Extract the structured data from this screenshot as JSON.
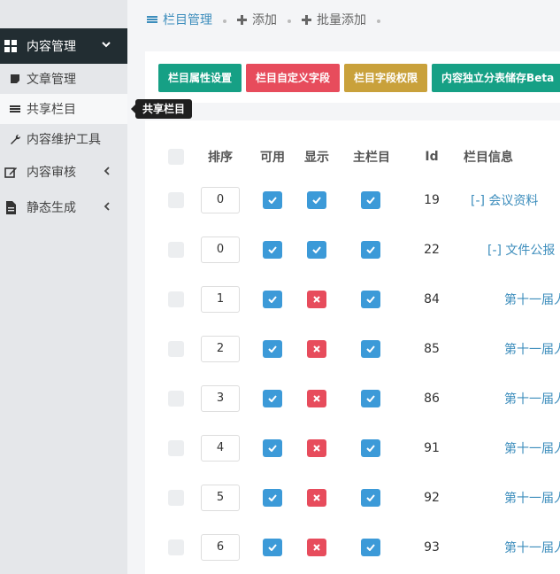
{
  "sidebar": {
    "section": "内容管理",
    "items": [
      {
        "label": "文章管理",
        "icon": "note-icon"
      },
      {
        "label": "共享栏目",
        "icon": "list-icon"
      },
      {
        "label": "内容维护工具",
        "icon": "wrench-icon"
      }
    ],
    "menus": [
      {
        "label": "内容审核",
        "icon": "edit-icon"
      },
      {
        "label": "静态生成",
        "icon": "file-icon"
      }
    ]
  },
  "tooltip": "共享栏目",
  "topnav": {
    "tabs": [
      "栏目管理",
      "添加",
      "批量添加"
    ]
  },
  "toolbar": {
    "buttons": [
      "栏目属性设置",
      "栏目自定义字段",
      "栏目字段权限",
      "内容独立分表储存Beta"
    ]
  },
  "table": {
    "headers": [
      "排序",
      "可用",
      "显示",
      "主栏目",
      "Id",
      "栏目信息"
    ],
    "rows": [
      {
        "sort": "0",
        "enabled": true,
        "display": true,
        "main": true,
        "id": "19",
        "info": "[-] 会议资料",
        "indent": 0
      },
      {
        "sort": "0",
        "enabled": true,
        "display": true,
        "main": true,
        "id": "22",
        "info": "[-] 文件公报",
        "indent": 1
      },
      {
        "sort": "1",
        "enabled": true,
        "display": false,
        "main": true,
        "id": "84",
        "info": "第十一届人",
        "indent": 2
      },
      {
        "sort": "2",
        "enabled": true,
        "display": false,
        "main": true,
        "id": "85",
        "info": "第十一届人",
        "indent": 2
      },
      {
        "sort": "3",
        "enabled": true,
        "display": false,
        "main": true,
        "id": "86",
        "info": "第十一届人",
        "indent": 2
      },
      {
        "sort": "4",
        "enabled": true,
        "display": false,
        "main": true,
        "id": "91",
        "info": "第十一届人",
        "indent": 2
      },
      {
        "sort": "5",
        "enabled": true,
        "display": false,
        "main": true,
        "id": "92",
        "info": "第十一届人",
        "indent": 2
      },
      {
        "sort": "6",
        "enabled": true,
        "display": false,
        "main": true,
        "id": "93",
        "info": "第十一届人",
        "indent": 2
      }
    ]
  },
  "colors": {
    "primary": "#3c9ad8",
    "danger": "#e74c5c",
    "teal": "#16a085",
    "gold": "#c9a13b",
    "sidebar_dark": "#222d32"
  }
}
